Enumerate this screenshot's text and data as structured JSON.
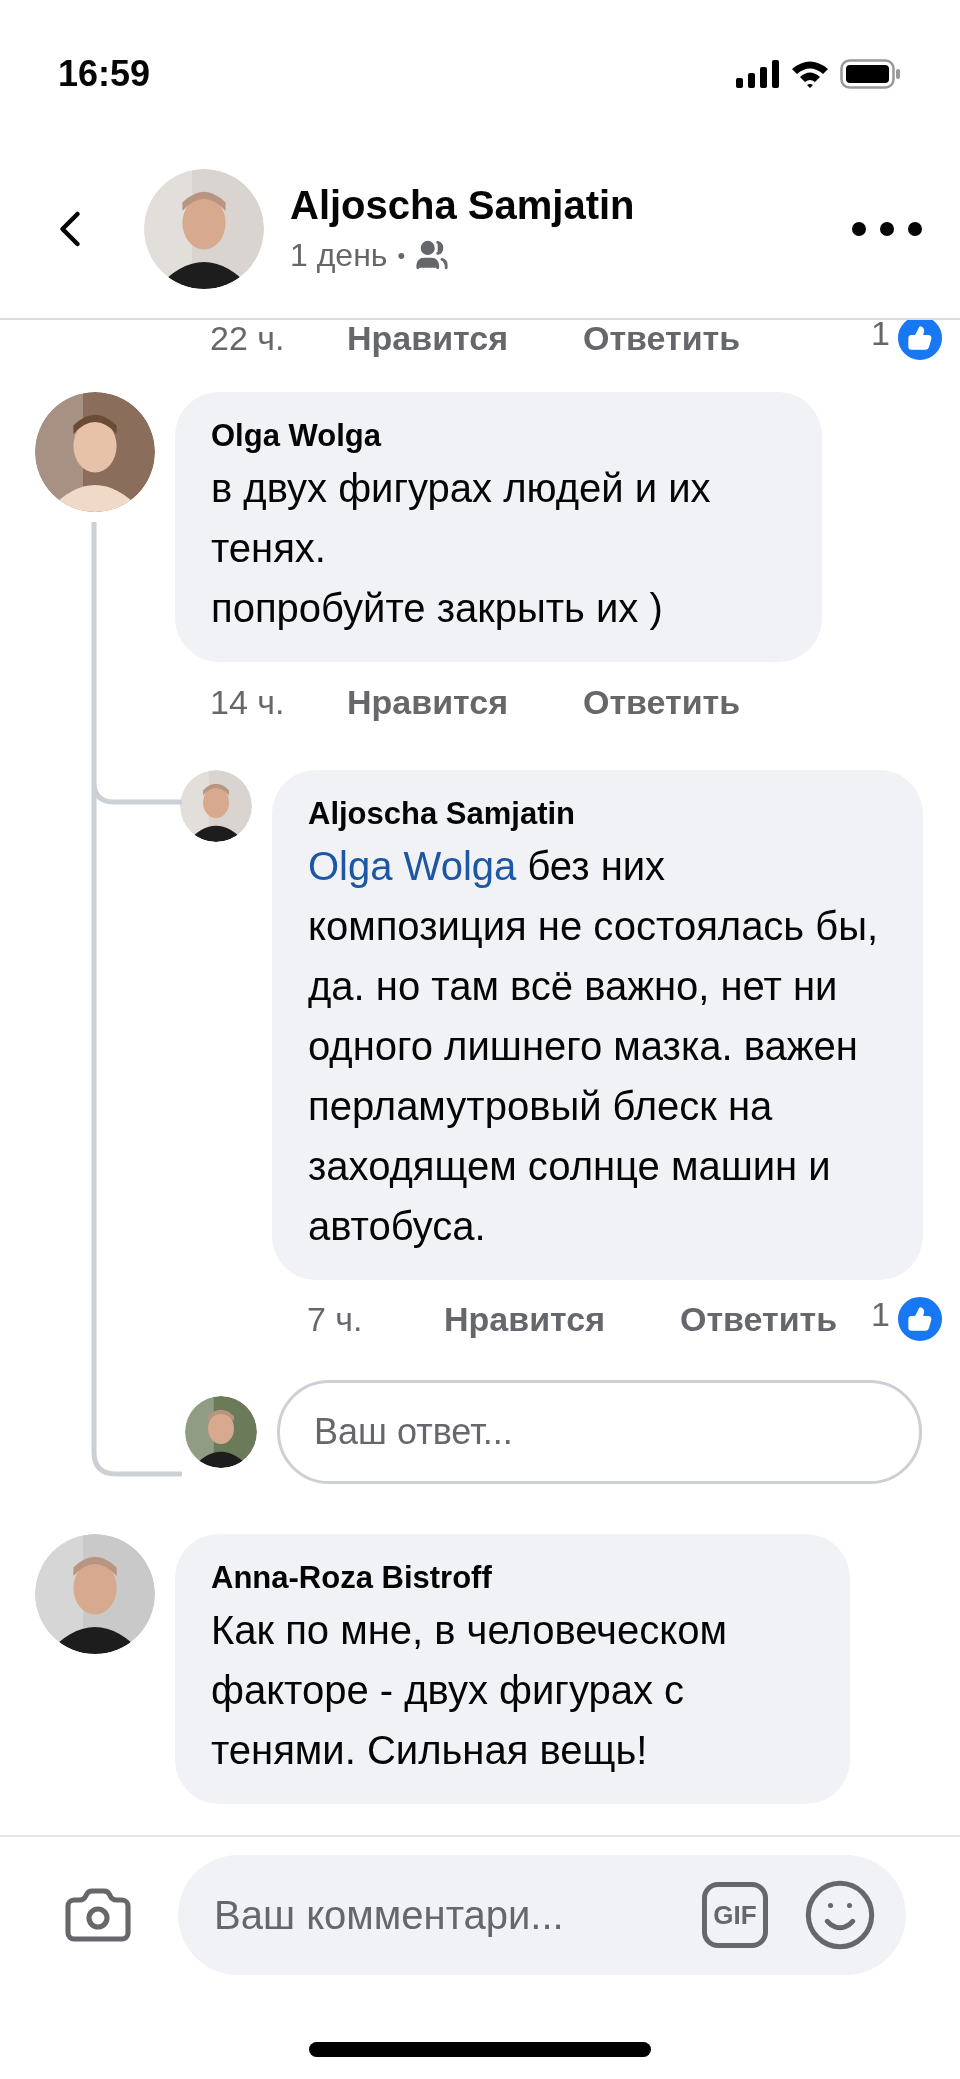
{
  "status_bar": {
    "time": "16:59"
  },
  "header": {
    "name": "Aljoscha Samjatin",
    "age": "1 день",
    "separator": "•"
  },
  "partial_meta": {
    "time": "22 ч.",
    "like": "Нравится",
    "reply": "Ответить",
    "reactions": "1"
  },
  "comments": [
    {
      "author": "Olga Wolga",
      "text": "в двух фигурах людей и их тенях.\nпопробуйте закрыть их )",
      "meta": {
        "time": "14 ч.",
        "like": "Нравится",
        "reply": "Ответить"
      },
      "replies": [
        {
          "author": "Aljoscha Samjatin",
          "mention": "Olga Wolga",
          "text": "без них композиция не состоялась бы, да. но там всё важно, нет ни одного лишнего мазка. важен перламутровый блеск на заходящем солнце машин и автобуса.",
          "meta": {
            "time": "7 ч.",
            "like": "Нравится",
            "reply": "Ответить",
            "reactions": "1"
          }
        }
      ],
      "reply_box": {
        "placeholder": "Ваш ответ..."
      }
    },
    {
      "author": "Anna-Roza Bistroff",
      "text": "Как по мне, в человеческом факторе - двух фигурах с тенями. Сильная вещь!"
    }
  ],
  "composer": {
    "placeholder": "Ваш комментари...",
    "gif_label": "GIF"
  }
}
